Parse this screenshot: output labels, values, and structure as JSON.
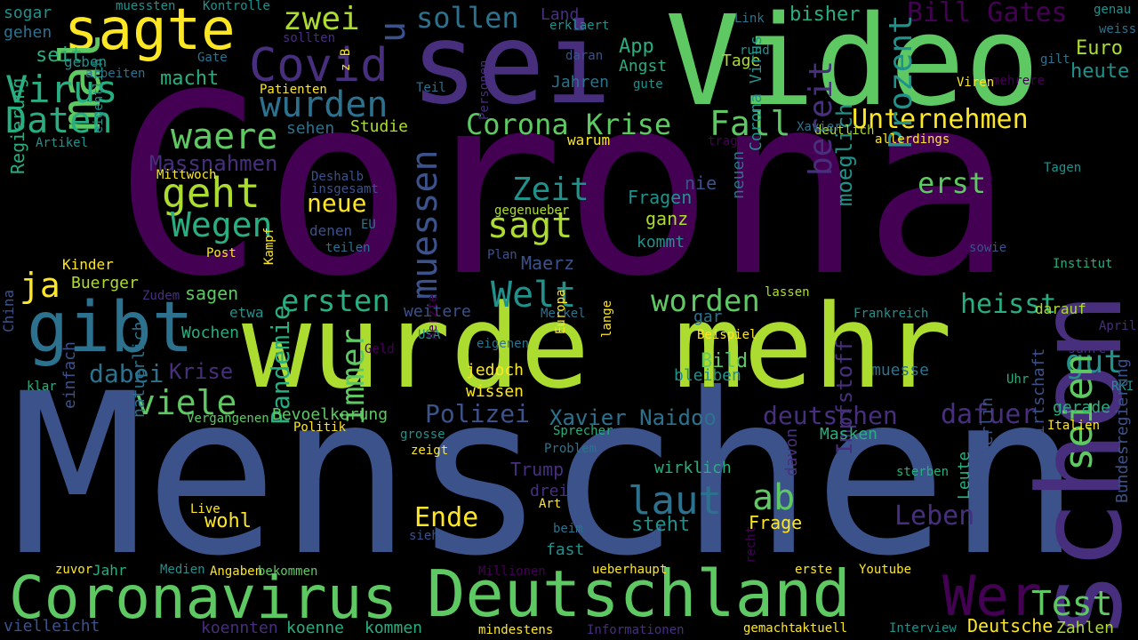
{
  "colors": {
    "background": "#000000",
    "palette": [
      "#440154",
      "#472f7d",
      "#3b528b",
      "#2c728e",
      "#21918c",
      "#28ae80",
      "#5ec962",
      "#addc30",
      "#fde725"
    ]
  },
  "words": [
    {
      "text": "Corona",
      "color": "#440154"
    },
    {
      "text": "Menschen",
      "color": "#3b528b"
    },
    {
      "text": "wurde",
      "color": "#addc30"
    },
    {
      "text": "mehr",
      "color": "#addc30"
    },
    {
      "text": "Video",
      "color": "#5ec962"
    },
    {
      "text": "sei",
      "color": "#472f7d"
    },
    {
      "text": "schon",
      "color": "#472f7d"
    },
    {
      "text": "Coronavirus",
      "color": "#5ec962"
    },
    {
      "text": "Deutschland",
      "color": "#5ec962"
    },
    {
      "text": "gibt",
      "color": "#2c728e"
    },
    {
      "text": "sagte",
      "color": "#fde725"
    },
    {
      "text": "Covid",
      "color": "#472f7d"
    },
    {
      "text": "mal",
      "color": "#5ec962"
    },
    {
      "text": "Virus",
      "color": "#28ae80"
    },
    {
      "text": "Daten",
      "color": "#28ae80"
    },
    {
      "text": "wurden",
      "color": "#2c728e"
    },
    {
      "text": "zwei",
      "color": "#addc30"
    },
    {
      "text": "sollen",
      "color": "#2c728e"
    },
    {
      "text": "Bill Gates",
      "color": "#440154"
    },
    {
      "text": "u",
      "color": "#3b528b"
    },
    {
      "text": "Corona Krise",
      "color": "#5ec962"
    },
    {
      "text": "Fall",
      "color": "#5ec962"
    },
    {
      "text": "Unternehmen",
      "color": "#fde725"
    },
    {
      "text": "waere",
      "color": "#5ec962"
    },
    {
      "text": "geht",
      "color": "#addc30"
    },
    {
      "text": "Wegen",
      "color": "#28ae80"
    },
    {
      "text": "Massnahmen",
      "color": "#472f7d"
    },
    {
      "text": "muessen",
      "color": "#3b528b"
    },
    {
      "text": "Zeit",
      "color": "#21918c"
    },
    {
      "text": "neue",
      "color": "#fde725"
    },
    {
      "text": "sagt",
      "color": "#addc30"
    },
    {
      "text": "Welt",
      "color": "#21918c"
    },
    {
      "text": "erst",
      "color": "#5ec962"
    },
    {
      "text": "bereit",
      "color": "#472f7d"
    },
    {
      "text": "Prozent",
      "color": "#21918c"
    },
    {
      "text": "moeglich",
      "color": "#21918c"
    },
    {
      "text": "ja",
      "color": "#fde725"
    },
    {
      "text": "viele",
      "color": "#5ec962"
    },
    {
      "text": "dabei",
      "color": "#2c728e"
    },
    {
      "text": "ersten",
      "color": "#28ae80"
    },
    {
      "text": "worden",
      "color": "#5ec962"
    },
    {
      "text": "heisst",
      "color": "#28ae80"
    },
    {
      "text": "gut",
      "color": "#21918c"
    },
    {
      "text": "Polizei",
      "color": "#3b528b"
    },
    {
      "text": "Xavier Naidoo",
      "color": "#2c728e"
    },
    {
      "text": "deutschen",
      "color": "#472f7d"
    },
    {
      "text": "dafuer",
      "color": "#472f7d"
    },
    {
      "text": "laut",
      "color": "#2c728e"
    },
    {
      "text": "ab",
      "color": "#5ec962"
    },
    {
      "text": "immer",
      "color": "#5ec962"
    },
    {
      "text": "Pandemie",
      "color": "#28ae80"
    },
    {
      "text": "Ende",
      "color": "#fde725"
    },
    {
      "text": "Leben",
      "color": "#472f7d"
    },
    {
      "text": "seien",
      "color": "#5ec962"
    },
    {
      "text": "Test",
      "color": "#5ec962"
    },
    {
      "text": "Wer",
      "color": "#440154"
    },
    {
      "text": "Impfstoff",
      "color": "#472f7d"
    },
    {
      "text": "Krise",
      "color": "#472f7d"
    },
    {
      "text": "Regierung",
      "color": "#28ae80"
    },
    {
      "text": "macht",
      "color": "#28ae80"
    },
    {
      "text": "seit",
      "color": "#28ae80"
    },
    {
      "text": "sogar",
      "color": "#21918c"
    },
    {
      "text": "gehen",
      "color": "#2c728e"
    },
    {
      "text": "muessten",
      "color": "#21918c"
    },
    {
      "text": "Kontrolle",
      "color": "#21918c"
    },
    {
      "text": "sollten",
      "color": "#472f7d"
    },
    {
      "text": "Land",
      "color": "#472f7d"
    },
    {
      "text": "erklaert",
      "color": "#21918c"
    },
    {
      "text": "Link",
      "color": "#2c728e"
    },
    {
      "text": "bisher",
      "color": "#28ae80"
    },
    {
      "text": "genau",
      "color": "#21918c"
    },
    {
      "text": "weiss",
      "color": "#2c728e"
    },
    {
      "text": "geben",
      "color": "#21918c"
    },
    {
      "text": "arbeiten",
      "color": "#2c728e"
    },
    {
      "text": "Gate",
      "color": "#2c728e"
    },
    {
      "text": "App",
      "color": "#28ae80"
    },
    {
      "text": "Angst",
      "color": "#28ae80"
    },
    {
      "text": "rund",
      "color": "#21918c"
    },
    {
      "text": "Tage",
      "color": "#addc30"
    },
    {
      "text": "Euro",
      "color": "#addc30"
    },
    {
      "text": "heute",
      "color": "#21918c"
    },
    {
      "text": "gilt",
      "color": "#2c728e"
    },
    {
      "text": "mehrere",
      "color": "#440154"
    },
    {
      "text": "Personen",
      "color": "#472f7d"
    },
    {
      "text": "daran",
      "color": "#3b528b"
    },
    {
      "text": "Patienten",
      "color": "#fde725"
    },
    {
      "text": "z B",
      "color": "#fde725"
    },
    {
      "text": "Teil",
      "color": "#2c728e"
    },
    {
      "text": "Jahren",
      "color": "#2c728e"
    },
    {
      "text": "gute",
      "color": "#21918c"
    },
    {
      "text": "Viren",
      "color": "#fde725"
    },
    {
      "text": "sehen",
      "color": "#2c728e"
    },
    {
      "text": "Studie",
      "color": "#addc30"
    },
    {
      "text": "warum",
      "color": "#fde725"
    },
    {
      "text": "deutlich",
      "color": "#addc30"
    },
    {
      "text": "Xavier",
      "color": "#2c728e"
    },
    {
      "text": "tragen",
      "color": "#440154"
    },
    {
      "text": "allerdings",
      "color": "#fde725"
    },
    {
      "text": "Artikel",
      "color": "#21918c"
    },
    {
      "text": "eigentlich",
      "color": "#21918c"
    },
    {
      "text": "Mittwoch",
      "color": "#fde725"
    },
    {
      "text": "Deshalb",
      "color": "#3b528b"
    },
    {
      "text": "insgesamt",
      "color": "#3b528b"
    },
    {
      "text": "Fragen",
      "color": "#21918c"
    },
    {
      "text": "nie",
      "color": "#3b528b"
    },
    {
      "text": "Corona Virus",
      "color": "#21918c"
    },
    {
      "text": "Tagen",
      "color": "#21918c"
    },
    {
      "text": "ganz",
      "color": "#addc30"
    },
    {
      "text": "kommt",
      "color": "#21918c"
    },
    {
      "text": "neuen",
      "color": "#2c728e"
    },
    {
      "text": "gegenueber",
      "color": "#addc30"
    },
    {
      "text": "EU",
      "color": "#2c728e"
    },
    {
      "text": "denen",
      "color": "#3b528b"
    },
    {
      "text": "teilen",
      "color": "#2c728e"
    },
    {
      "text": "sowie",
      "color": "#3b528b"
    },
    {
      "text": "Post",
      "color": "#fde725"
    },
    {
      "text": "Kinder",
      "color": "#fde725"
    },
    {
      "text": "Plan",
      "color": "#3b528b"
    },
    {
      "text": "Maerz",
      "color": "#3b528b"
    },
    {
      "text": "Institut",
      "color": "#28ae80"
    },
    {
      "text": "Buerger",
      "color": "#addc30"
    },
    {
      "text": "Zudem",
      "color": "#472f7d"
    },
    {
      "text": "sagen",
      "color": "#5ec962"
    },
    {
      "text": "Kampf",
      "color": "#fde725"
    },
    {
      "text": "lassen",
      "color": "#addc30"
    },
    {
      "text": "etwa",
      "color": "#21918c"
    },
    {
      "text": "weitere",
      "color": "#3b528b"
    },
    {
      "text": "Merkel",
      "color": "#2c728e"
    },
    {
      "text": "gar",
      "color": "#2c728e"
    },
    {
      "text": "darauf",
      "color": "#addc30"
    },
    {
      "text": "Frankreich",
      "color": "#21918c"
    },
    {
      "text": "China",
      "color": "#3b528b"
    },
    {
      "text": "Wochen",
      "color": "#28ae80"
    },
    {
      "text": "Geld",
      "color": "#440154"
    },
    {
      "text": "USA",
      "color": "#21918c"
    },
    {
      "text": "eigenen",
      "color": "#2c728e"
    },
    {
      "text": "Beispiel",
      "color": "#fde725"
    },
    {
      "text": "Jahre",
      "color": "#472f7d"
    },
    {
      "text": "April",
      "color": "#472f7d"
    },
    {
      "text": "Europa",
      "color": "#fde725"
    },
    {
      "text": "lange",
      "color": "#fde725"
    },
    {
      "text": "Bild",
      "color": "#5ec962"
    },
    {
      "text": "muesse",
      "color": "#2c728e"
    },
    {
      "text": "Aerzte",
      "color": "#440154"
    },
    {
      "text": "jedoch",
      "color": "#fde725"
    },
    {
      "text": "wissen",
      "color": "#fde725"
    },
    {
      "text": "bleiben",
      "color": "#21918c"
    },
    {
      "text": "Uhr",
      "color": "#28ae80"
    },
    {
      "text": "RKI",
      "color": "#21918c"
    },
    {
      "text": "klar",
      "color": "#28ae80"
    },
    {
      "text": "Bevoelkerung",
      "color": "#5ec962"
    },
    {
      "text": "gerade",
      "color": "#28ae80"
    },
    {
      "text": "Vergangenen",
      "color": "#5ec962"
    },
    {
      "text": "Politik",
      "color": "#fde725"
    },
    {
      "text": "grosse",
      "color": "#21918c"
    },
    {
      "text": "Sprecher",
      "color": "#28ae80"
    },
    {
      "text": "Masken",
      "color": "#28ae80"
    },
    {
      "text": "Italien",
      "color": "#fde725"
    },
    {
      "text": "einfach",
      "color": "#3b528b"
    },
    {
      "text": "natuerlich",
      "color": "#2c728e"
    },
    {
      "text": "zeigt",
      "color": "#fde725"
    },
    {
      "text": "Problem",
      "color": "#2c728e"
    },
    {
      "text": "Trump",
      "color": "#472f7d"
    },
    {
      "text": "wirklich",
      "color": "#28ae80"
    },
    {
      "text": "sterben",
      "color": "#28ae80"
    },
    {
      "text": "drei",
      "color": "#472f7d"
    },
    {
      "text": "Live",
      "color": "#fde725"
    },
    {
      "text": "Art",
      "color": "#fde725"
    },
    {
      "text": "wohl",
      "color": "#fde725"
    },
    {
      "text": "steht",
      "color": "#21918c"
    },
    {
      "text": "Frage",
      "color": "#fde725"
    },
    {
      "text": "davon",
      "color": "#472f7d"
    },
    {
      "text": "Berlin",
      "color": "#3b528b"
    },
    {
      "text": "Leute",
      "color": "#28ae80"
    },
    {
      "text": "Wirtschaft",
      "color": "#3b528b"
    },
    {
      "text": "Bundesregierung",
      "color": "#3b528b"
    },
    {
      "text": "beim",
      "color": "#2c728e"
    },
    {
      "text": "sieht",
      "color": "#3b528b"
    },
    {
      "text": "fast",
      "color": "#21918c"
    },
    {
      "text": "zuvor",
      "color": "#fde725"
    },
    {
      "text": "Jahr",
      "color": "#28ae80"
    },
    {
      "text": "Medien",
      "color": "#21918c"
    },
    {
      "text": "Angaben",
      "color": "#fde725"
    },
    {
      "text": "bekommen",
      "color": "#5ec962"
    },
    {
      "text": "Millionen",
      "color": "#440154"
    },
    {
      "text": "ueberhaupt",
      "color": "#fde725"
    },
    {
      "text": "recht",
      "color": "#440154"
    },
    {
      "text": "erste",
      "color": "#fde725"
    },
    {
      "text": "Youtube",
      "color": "#fde725"
    },
    {
      "text": "vielleicht",
      "color": "#3b528b"
    },
    {
      "text": "koennten",
      "color": "#472f7d"
    },
    {
      "text": "koenne",
      "color": "#28ae80"
    },
    {
      "text": "kommen",
      "color": "#28ae80"
    },
    {
      "text": "mindestens",
      "color": "#fde725"
    },
    {
      "text": "Informationen",
      "color": "#472f7d"
    },
    {
      "text": "gemacht",
      "color": "#fde725"
    },
    {
      "text": "aktuell",
      "color": "#fde725"
    },
    {
      "text": "Interview",
      "color": "#21918c"
    },
    {
      "text": "Deutsche",
      "color": "#fde725"
    },
    {
      "text": "Zahlen",
      "color": "#addc30"
    }
  ]
}
